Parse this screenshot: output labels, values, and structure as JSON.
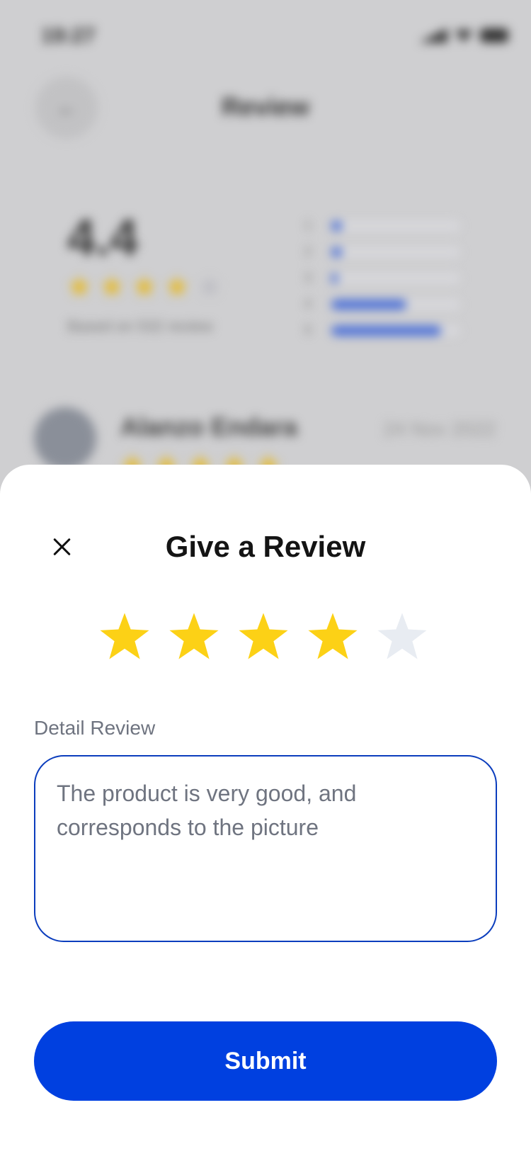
{
  "background": {
    "status_time": "19:27",
    "title": "Review",
    "rating": "4.4",
    "rating_stars": [
      1,
      1,
      1,
      1,
      0
    ],
    "rating_subtext": "Based on 532 review",
    "distribution": [
      {
        "label": "1",
        "fraction": 0.08
      },
      {
        "label": "2",
        "fraction": 0.08
      },
      {
        "label": "3",
        "fraction": 0.05
      },
      {
        "label": "4",
        "fraction": 0.58
      },
      {
        "label": "5",
        "fraction": 0.85
      }
    ],
    "reviewer": {
      "name": "Alanzo Endara",
      "date": "24 Nov 2022",
      "stars": 5
    }
  },
  "sheet": {
    "title": "Give a Review",
    "rating_value": 4,
    "rating_max": 5,
    "field_label": "Detail Review",
    "review_text": "The product is very good, and corresponds to the picture",
    "submit_label": "Submit"
  },
  "colors": {
    "accent": "#0040e0",
    "star_on": "#fcd116",
    "star_off": "#e8ecf2",
    "input_border": "#0b3dbd"
  }
}
